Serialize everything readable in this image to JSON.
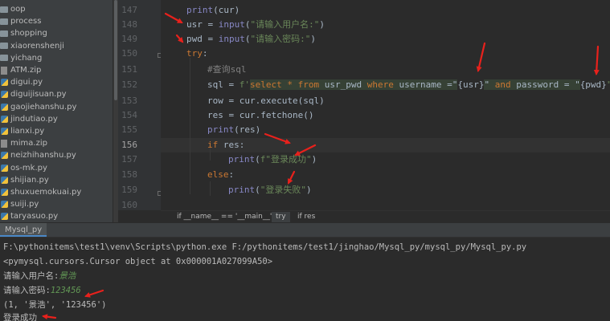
{
  "project_tree": [
    {
      "label": "oop",
      "type": "folder"
    },
    {
      "label": "process",
      "type": "folder"
    },
    {
      "label": "shopping",
      "type": "folder"
    },
    {
      "label": "xiaorenshenji",
      "type": "folder"
    },
    {
      "label": "yichang",
      "type": "folder"
    },
    {
      "label": "ATM.zip",
      "type": "zip"
    },
    {
      "label": "digui.py",
      "type": "py"
    },
    {
      "label": "diguijisuan.py",
      "type": "py"
    },
    {
      "label": "gaojiehanshu.py",
      "type": "py"
    },
    {
      "label": "jindutiao.py",
      "type": "py"
    },
    {
      "label": "lianxi.py",
      "type": "py"
    },
    {
      "label": "mima.zip",
      "type": "zip"
    },
    {
      "label": "neizhihanshu.py",
      "type": "py"
    },
    {
      "label": "os-mk.py",
      "type": "py"
    },
    {
      "label": "shijian.py",
      "type": "py"
    },
    {
      "label": "shuxuemokuai.py",
      "type": "py"
    },
    {
      "label": "suiji.py",
      "type": "py"
    },
    {
      "label": "taryasuo.py",
      "type": "py"
    }
  ],
  "editor": {
    "line_numbers": [
      "147",
      "148",
      "149",
      "150",
      "151",
      "152",
      "153",
      "154",
      "155",
      "156",
      "157",
      "158",
      "159",
      "160"
    ],
    "current_line": "156",
    "code": {
      "l147": {
        "fn": "print",
        "rest": "(cur)"
      },
      "l148": {
        "var": "usr = ",
        "fn": "input",
        "open": "(",
        "str": "\"请输入用户名:\"",
        "close": ")"
      },
      "l149": {
        "var": "pwd = ",
        "fn": "input",
        "open": "(",
        "str": "\"请输入密码:\"",
        "close": ")"
      },
      "l150": {
        "kw": "try",
        "colon": ":"
      },
      "l151": {
        "comment": "#查询sql"
      },
      "l152": {
        "prefix": "sql = ",
        "fprefix": "f'",
        "t1": "select",
        "t2": " * ",
        "t3": "from",
        "t4": " usr_pwd ",
        "t5": "where",
        "t6": " username =\"",
        "b1": "{usr}",
        "t7": "\" ",
        "t8": "and",
        "t9": " password = \"",
        "b2": "{pwd}",
        "t10": "\"'"
      },
      "l153": {
        "text": "row = cur.execute(sql)"
      },
      "l154": {
        "text": "res = cur.fetchone()"
      },
      "l155": {
        "fn": "print",
        "rest": "(res)"
      },
      "l156": {
        "kw": "if",
        "rest": " res:"
      },
      "l157": {
        "fn": "print",
        "open": "(",
        "str": "f\"登录成功\"",
        "close": ")"
      },
      "l158": {
        "kw": "else",
        "colon": ":"
      },
      "l159": {
        "fn": "print",
        "open": "(",
        "str": "\"登录失败\"",
        "close": ")"
      }
    }
  },
  "breadcrumb": [
    "if __name__ == '__main__'",
    "try",
    "if res"
  ],
  "run_panel": {
    "tab_label": "Mysql_py",
    "lines": {
      "cmd": "F:\\pythonitems\\test1\\venv\\Scripts\\python.exe F:/pythonitems/test1/jinghao/Mysql_py/mysql_py/Mysql_py.py",
      "cursor": "<pymysql.cursors.Cursor object at 0x000001A027099A50>",
      "prompt_user": "请输入用户名:",
      "input_user": "景浩",
      "prompt_pwd": "请输入密码:",
      "input_pwd": "123456",
      "result": "(1, '景浩', '123456')",
      "login": "登录成功"
    }
  },
  "colors": {
    "keyword": "#cc7832",
    "function": "#ffc66d",
    "builtin": "#8888c6",
    "string": "#6a8759",
    "comment": "#808080",
    "default": "#a9b7c6",
    "arrow": "#e8211c",
    "console_input": "#629755"
  },
  "icons": {
    "folder": "folder-icon",
    "zip": "zip-file-icon",
    "py": "python-file-icon"
  }
}
